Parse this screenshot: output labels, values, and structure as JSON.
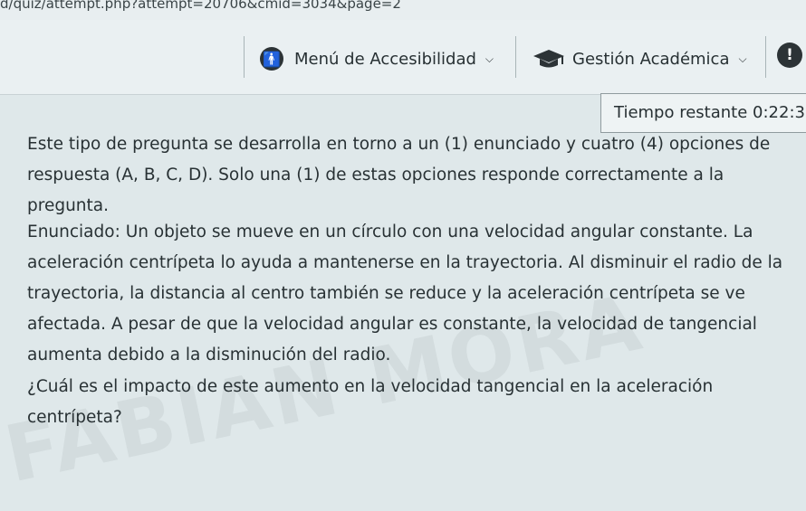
{
  "browser": {
    "url": "d/quiz/attempt.php?attempt=20706&cmid=3034&page=2"
  },
  "nav": {
    "accessibility_label": "Menú de Accesibilidad",
    "academic_label": "Gestión Académica"
  },
  "timer": {
    "label": "Tiempo restante",
    "value": "0:22:3"
  },
  "question": {
    "intro": "Este tipo de pregunta se desarrolla en torno a un (1) enunciado y cuatro (4) opciones de respuesta (A, B, C, D). Solo una (1) de estas opciones responde correctamente a la pregunta.",
    "statement": "Enunciado: Un objeto se mueve en un círculo con una velocidad angular constante. La aceleración centrípeta lo ayuda a mantenerse en la trayectoria. Al disminuir el radio de la trayectoria, la distancia al centro también se reduce y la aceleración centrípeta se ve afectada. A pesar de que la velocidad angular es constante, la velocidad de tangencial aumenta debido a la disminución del radio.",
    "prompt": "¿Cuál es el impacto de este aumento en la velocidad tangencial en la aceleración centrípeta?"
  },
  "watermark": "FABIAN MORA"
}
